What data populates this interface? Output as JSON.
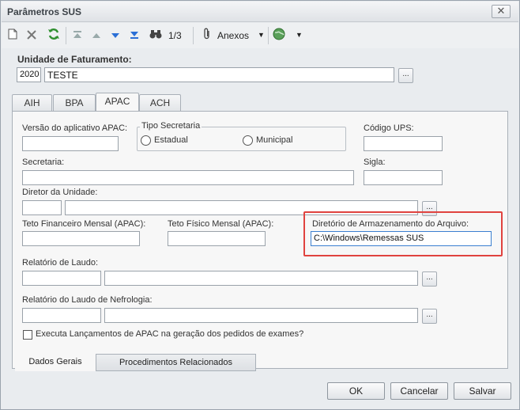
{
  "window": {
    "title": "Parâmetros SUS",
    "close_glyph": "✕"
  },
  "toolbar": {
    "record_counter": "1/3",
    "attachments_label": "Anexos",
    "icons": [
      "new-document-icon",
      "delete-icon",
      "refresh-icon",
      "first-record-icon",
      "previous-record-icon",
      "next-record-icon",
      "last-record-icon",
      "binoculars-search-icon",
      "paperclip-icon",
      "globe-icon"
    ]
  },
  "billing_unit": {
    "label": "Unidade de Faturamento:",
    "code": "2020",
    "name": "TESTE",
    "lookup": "..."
  },
  "tabs": [
    "AIH",
    "BPA",
    "APAC",
    "ACH"
  ],
  "active_tab": "APAC",
  "apac": {
    "app_version_label": "Versão do aplicativo APAC:",
    "app_version_value": "",
    "secretaria_type": {
      "legend": "Tipo Secretaria",
      "option1": "Estadual",
      "option2": "Municipal"
    },
    "ups_code_label": "Código UPS:",
    "ups_code_value": "",
    "secretaria_label": "Secretaria:",
    "secretaria_value": "",
    "sigla_label": "Sigla:",
    "sigla_value": "",
    "director_label": "Diretor da Unidade:",
    "financial_ceiling_label": "Teto Financeiro Mensal (APAC):",
    "physical_ceiling_label": "Teto Físico Mensal (APAC):",
    "storage_dir_label": "Diretório de Armazenamento do Arquivo:",
    "storage_dir_value": "C:\\Windows\\Remessas SUS",
    "report_label": "Relatório de Laudo:",
    "nephro_report_label": "Relatório do Laudo de Nefrologia:",
    "execute_checkbox_label": "Executa Lançamentos de APAC na geração dos pedidos de exames?",
    "lookup": "..."
  },
  "bottom_tabs": [
    "Dados Gerais",
    "Procedimentos Relacionados"
  ],
  "buttons": {
    "ok": "OK",
    "cancel": "Cancelar",
    "save": "Salvar"
  }
}
